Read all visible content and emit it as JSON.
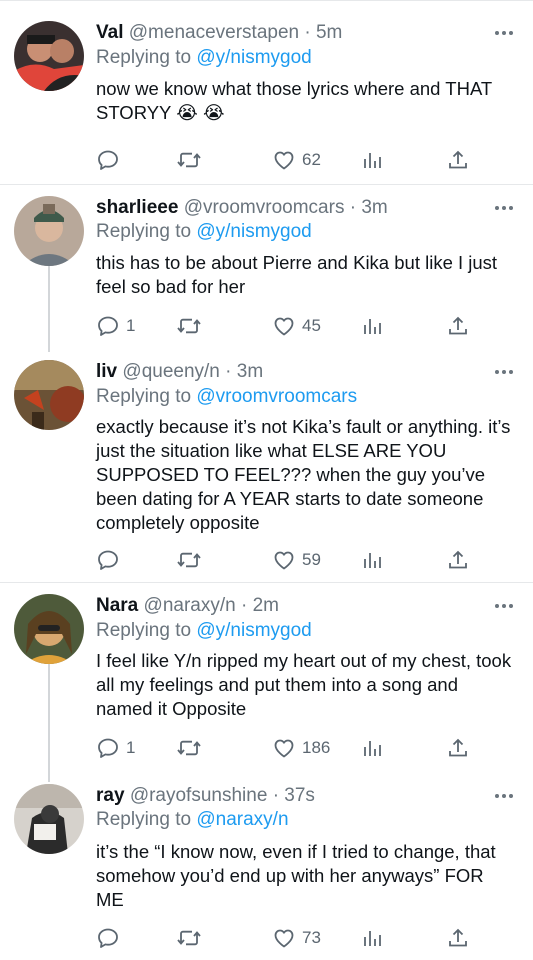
{
  "tweets": [
    {
      "name": "Val",
      "handle": "@menaceverstapen",
      "time": "· 5m",
      "replying_label": "Replying to",
      "replying_to": "@y/nismygod",
      "text": "now we know what those lyrics where and THAT STORYY 😭 😭",
      "replies": "",
      "retweets": "",
      "likes": "62"
    },
    {
      "name": "sharlieee",
      "handle": "@vroomvroomcars",
      "time": "· 3m",
      "replying_label": "Replying to",
      "replying_to": "@y/nismygod",
      "text": "this has to be about Pierre and Kika but like I just feel so bad for her",
      "replies": "1",
      "retweets": "",
      "likes": "45"
    },
    {
      "name": "liv",
      "handle": "@queeny/n",
      "time": "· 3m",
      "replying_label": "Replying to",
      "replying_to": "@vroomvroomcars",
      "text": "exactly because it’s not Kika’s fault or anything. it’s just the situation like what ELSE ARE YOU SUPPOSED TO FEEL??? when the guy you’ve been dating for A YEAR starts to date someone completely opposite",
      "replies": "",
      "retweets": "",
      "likes": "59"
    },
    {
      "name": "Nara",
      "handle": "@naraxy/n",
      "time": "· 2m",
      "replying_label": "Replying to",
      "replying_to": "@y/nismygod",
      "text": "I feel like Y/n ripped my heart out of my chest, took all my feelings and put them into a song and named it Opposite",
      "replies": "1",
      "retweets": "",
      "likes": "186"
    },
    {
      "name": "ray",
      "handle": "@rayofsunshine",
      "time": "· 37s",
      "replying_label": "Replying to",
      "replying_to": "@naraxy/n",
      "text": "it’s the “I know now, even if I tried to change, that somehow you’d end up with her anyways” FOR ME",
      "replies": "",
      "retweets": "",
      "likes": "73"
    }
  ],
  "colors": {
    "link": "#1d9bf0",
    "secondary": "#6a747d",
    "icon": "#5b6670",
    "divider": "#e6e8ea",
    "thread_line": "#d3d6d9"
  },
  "icons": [
    "reply-icon",
    "retweet-icon",
    "like-icon",
    "analytics-icon",
    "share-icon",
    "more-icon"
  ]
}
